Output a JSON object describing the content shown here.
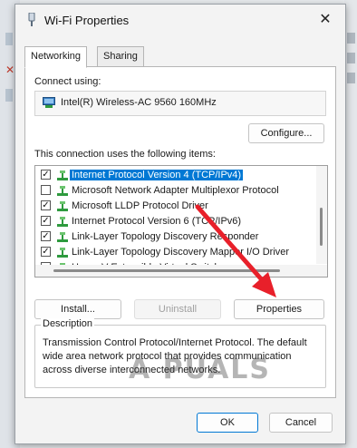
{
  "window": {
    "title": "Wi-Fi Properties"
  },
  "tabs": [
    {
      "label": "Networking"
    },
    {
      "label": "Sharing"
    }
  ],
  "connect": {
    "label": "Connect using:",
    "adapter": "Intel(R) Wireless-AC 9560 160MHz",
    "configure_label": "Configure..."
  },
  "items": {
    "label": "This connection uses the following items:",
    "list": [
      {
        "text": "Internet Protocol Version 4 (TCP/IPv4)",
        "checked": true,
        "selected": true
      },
      {
        "text": "Microsoft Network Adapter Multiplexor Protocol",
        "checked": false,
        "selected": false
      },
      {
        "text": "Microsoft LLDP Protocol Driver",
        "checked": true,
        "selected": false
      },
      {
        "text": "Internet Protocol Version 6 (TCP/IPv6)",
        "checked": true,
        "selected": false
      },
      {
        "text": "Link-Layer Topology Discovery Responder",
        "checked": true,
        "selected": false
      },
      {
        "text": "Link-Layer Topology Discovery Mapper I/O Driver",
        "checked": true,
        "selected": false
      },
      {
        "text": "Hyper-V Extensible Virtual Switch",
        "checked": false,
        "selected": false
      }
    ]
  },
  "actions": {
    "install_label": "Install...",
    "uninstall_label": "Uninstall",
    "properties_label": "Properties"
  },
  "description": {
    "legend": "Description",
    "text": "Transmission Control Protocol/Internet Protocol. The default wide area network protocol that provides communication across diverse interconnected networks."
  },
  "footer": {
    "ok_label": "OK",
    "cancel_label": "Cancel"
  },
  "watermark": "A PUALS",
  "colors": {
    "accent": "#0078d4",
    "arrow": "#e8202a",
    "protocol_icon": "#2e9a3e"
  }
}
